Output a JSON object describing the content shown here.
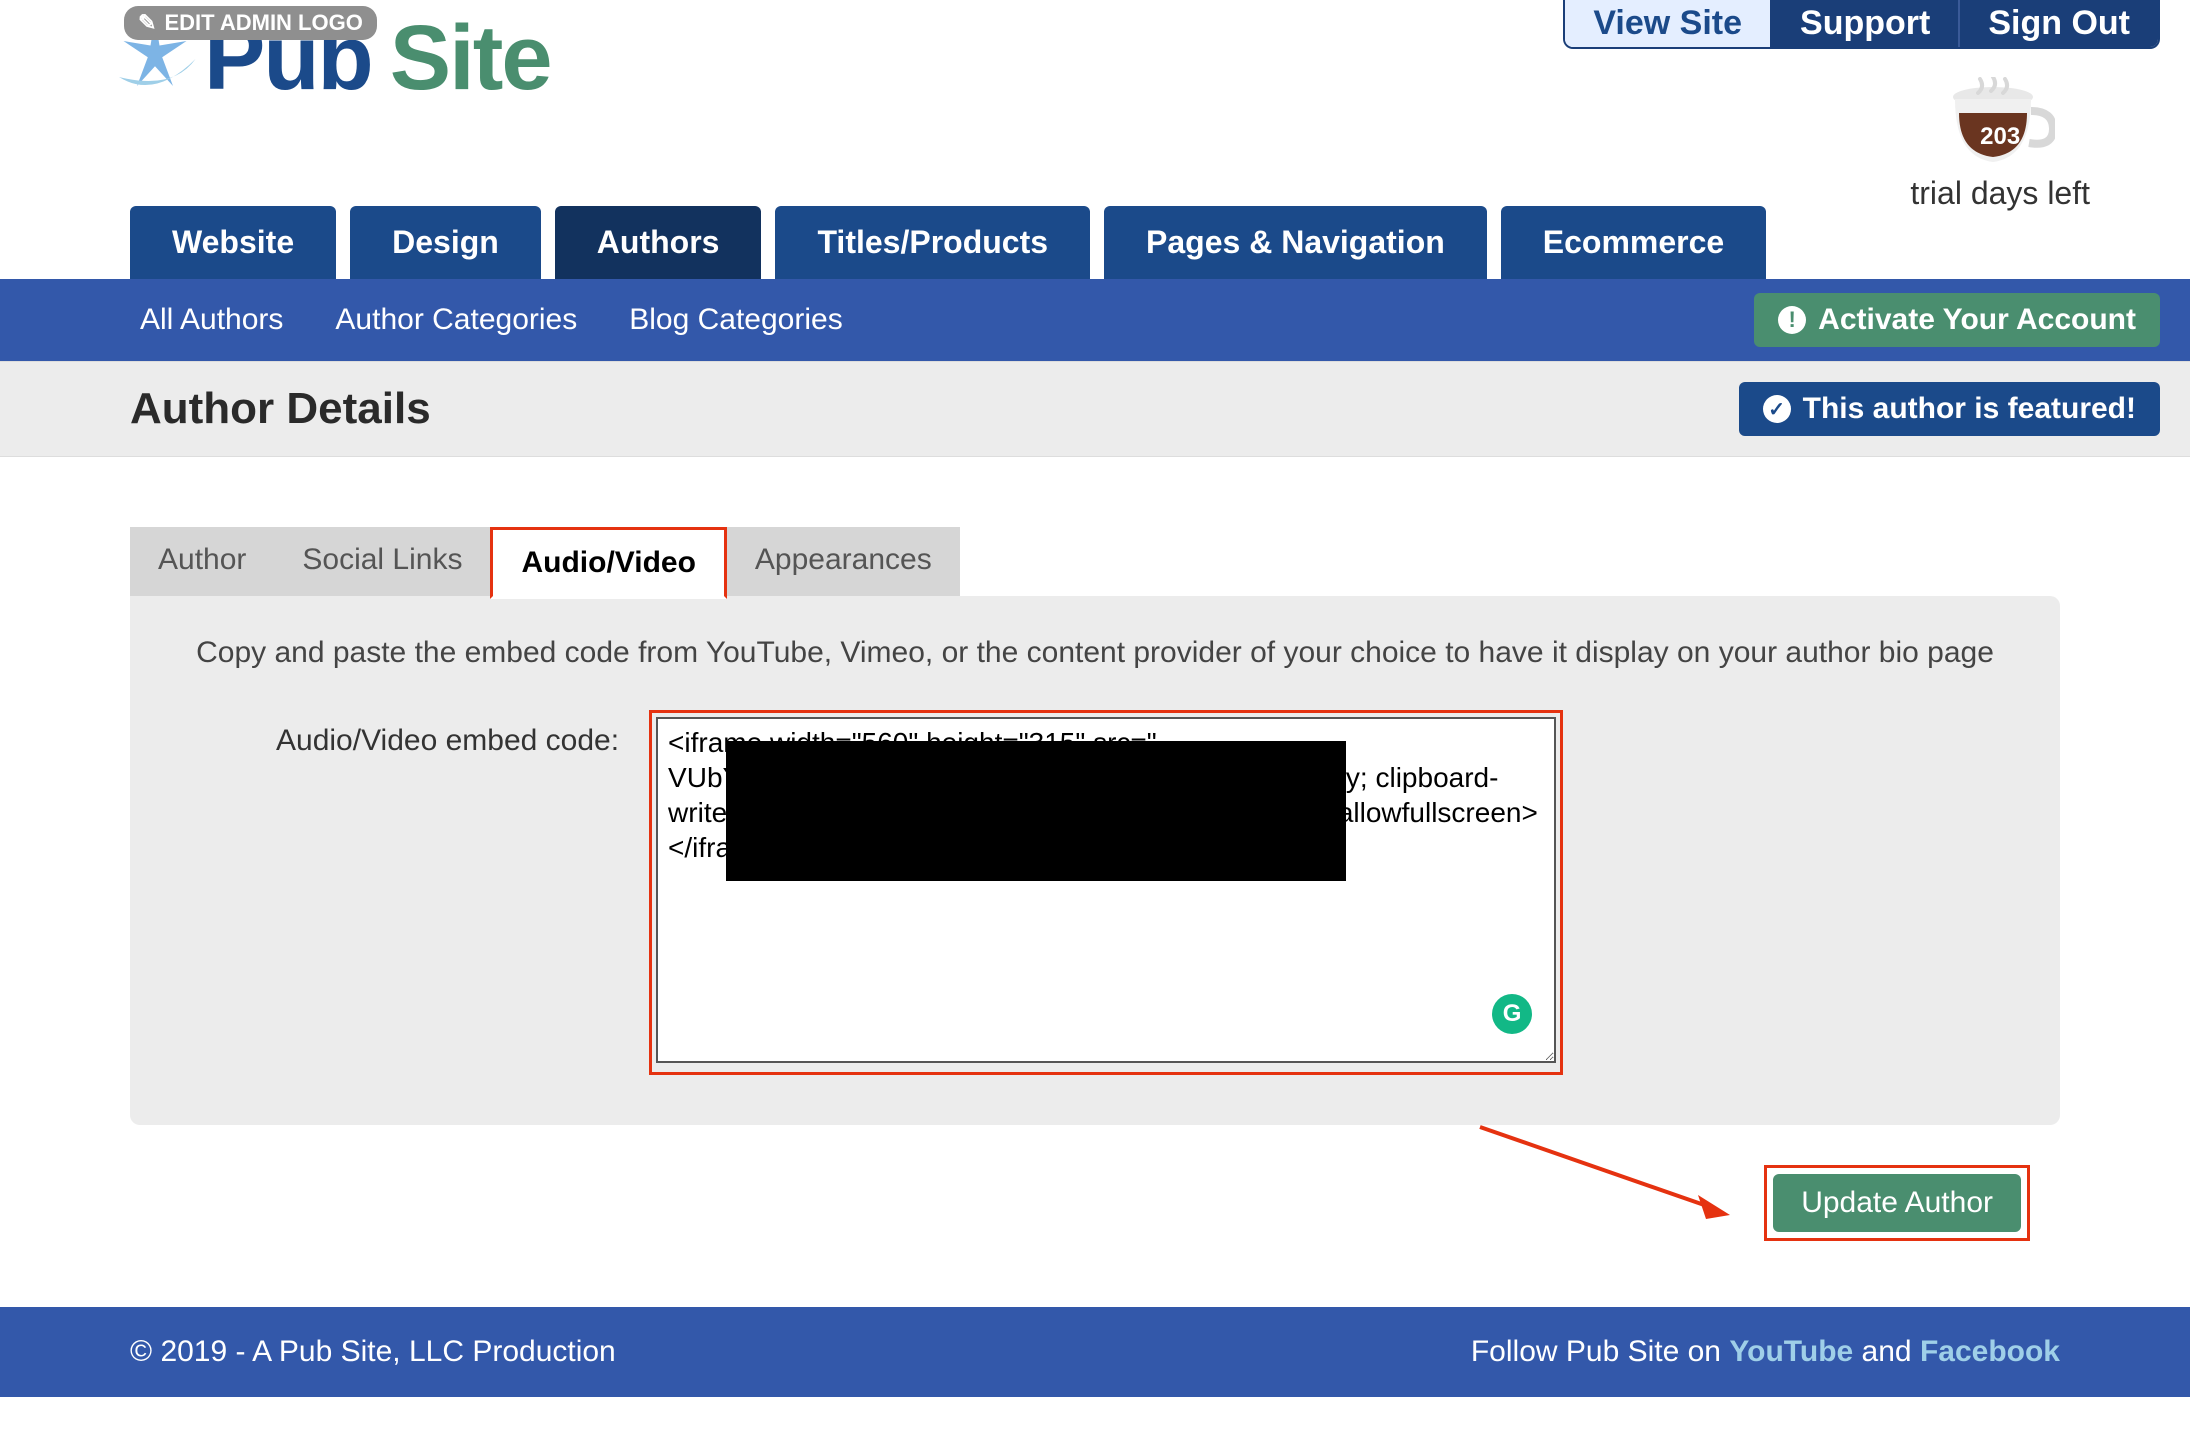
{
  "header": {
    "edit_logo_label": "EDIT ADMIN LOGO",
    "logo_pub": "Pub",
    "logo_site": "Site",
    "top_links": {
      "view": "View Site",
      "support": "Support",
      "signout": "Sign Out"
    },
    "trial": {
      "days": "203",
      "label": "trial days left"
    }
  },
  "nav": {
    "items": [
      "Website",
      "Design",
      "Authors",
      "Titles/Products",
      "Pages & Navigation",
      "Ecommerce"
    ],
    "active_index": 2
  },
  "subnav": {
    "items": [
      "All Authors",
      "Author Categories",
      "Blog Categories"
    ],
    "activate_label": "Activate Your Account"
  },
  "page": {
    "title": "Author Details",
    "featured_label": "This author is featured!"
  },
  "tabs": {
    "items": [
      "Author",
      "Social Links",
      "Audio/Video",
      "Appearances"
    ],
    "active_index": 2
  },
  "form": {
    "instructions": "Copy and paste the embed code from YouTube, Vimeo, or the content provider of your choice to have it display on your author bio page",
    "label": "Audio/Video embed code:",
    "textarea_value": "<iframe width=\"560\" height=\"315\" src=\"                                         VUbY\" frameborder=\"0\" allow=\"accelerometer; autoplay; clipboard-write; encrypted-media; gyroscope; picture-in-picture\" allowfullscreen></iframe>",
    "grammarly_char": "G",
    "update_label": "Update Author"
  },
  "footer": {
    "copyright": "© 2019 - A Pub Site, LLC Production",
    "follow_prefix": "Follow Pub Site on ",
    "youtube": "YouTube",
    "and": " and ",
    "facebook": "Facebook"
  }
}
